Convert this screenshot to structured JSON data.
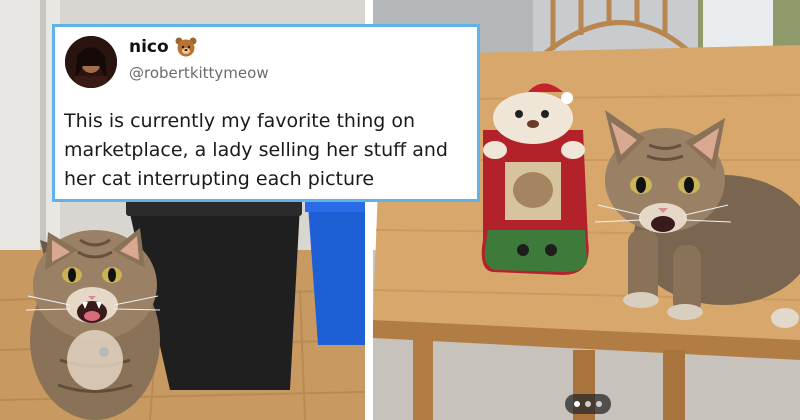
{
  "tweet": {
    "display_name": "nico",
    "name_emoji": "bear-face",
    "handle": "@robertkittymeow",
    "text": "This is currently my favorite thing on marketplace, a lady selling her stuff and her cat interrupting each picture"
  },
  "photos": [
    {
      "subject": "tabby cat meowing beside black trash bin"
    },
    {
      "subject": "tabby cat on wooden table next to cat Christmas stocking"
    }
  ],
  "carousel": {
    "count": 3,
    "active_index": 0
  },
  "colors": {
    "tweet_border": "#5fb3e6",
    "handle": "#6b6b6b"
  }
}
